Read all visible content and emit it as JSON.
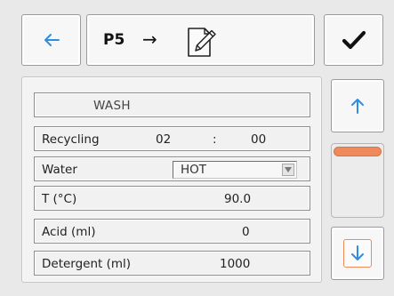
{
  "header": {
    "back_icon": "arrow-left-icon",
    "program": "P5",
    "arrow": "→",
    "edit_icon": "edit-document-icon",
    "confirm_icon": "check-icon"
  },
  "form": {
    "title": "WASH",
    "recycling": {
      "label": "Recycling",
      "minutes": "02",
      "separator": ":",
      "seconds": "00"
    },
    "water": {
      "label": "Water",
      "selected": "HOT"
    },
    "temperature": {
      "label": "T (°C)",
      "value": "90.0"
    },
    "acid": {
      "label": "Acid (ml)",
      "value": "0"
    },
    "detergent": {
      "label": "Detergent (ml)",
      "value": "1000"
    }
  },
  "scroll": {
    "up_icon": "arrow-up-icon",
    "down_icon": "arrow-down-icon",
    "position": 0.0
  },
  "colors": {
    "accent_blue": "#2f8de4",
    "accent_orange": "#ee8a5b",
    "check": "#111111"
  }
}
